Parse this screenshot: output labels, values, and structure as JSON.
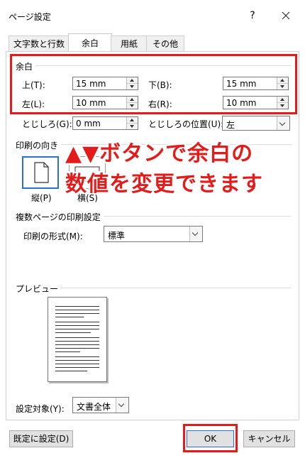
{
  "dialog": {
    "title": "ページ設定",
    "help": "?"
  },
  "tabs": [
    "文字数と行数",
    "余白",
    "用紙",
    "その他"
  ],
  "margins": {
    "group_label": "余白",
    "top_label": "上(T):",
    "top_value": "15 mm",
    "bottom_label": "下(B):",
    "bottom_value": "15 mm",
    "left_label": "左(L):",
    "left_value": "10 mm",
    "right_label": "右(R):",
    "right_value": "10 mm",
    "gutter_label": "とじしろ(G):",
    "gutter_value": "0 mm",
    "gutter_pos_label": "とじしろの位置(U):",
    "gutter_pos_value": "左"
  },
  "orientation": {
    "group_label": "印刷の向き",
    "portrait_label": "縦(P)",
    "landscape_label": "横(S)"
  },
  "pages": {
    "group_label": "複数ページの印刷設定",
    "format_label": "印刷の形式(M):",
    "format_value": "標準"
  },
  "preview": {
    "group_label": "プレビュー"
  },
  "apply": {
    "label": "設定対象(Y):",
    "value": "文書全体"
  },
  "buttons": {
    "default": "既定に設定(D)",
    "ok": "OK",
    "cancel": "キャンセル"
  },
  "annotation": {
    "line1": "▲▼ボタンで余白の",
    "line2": "数値を変更できます"
  },
  "colors": {
    "highlight": "#e31b1b",
    "selection": "#2b6fd6"
  }
}
